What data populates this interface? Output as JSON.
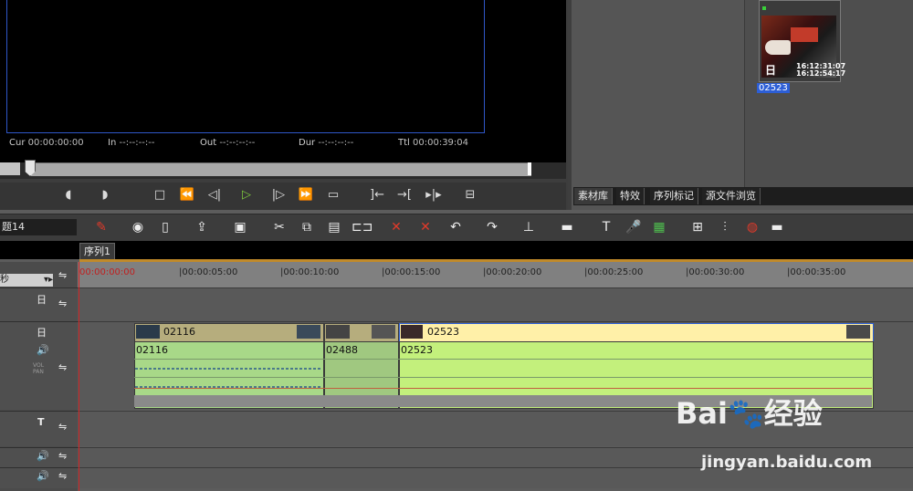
{
  "preview": {
    "cur_label": "Cur",
    "cur_value": "00:00:00:00",
    "in_label": "In",
    "in_value": "--:--:--:--",
    "out_label": "Out",
    "out_value": "--:--:--:--",
    "dur_label": "Dur",
    "dur_value": "--:--:--:--",
    "ttl_label": "Ttl",
    "ttl_value": "00:00:39:04",
    "scrub_progress": 0.0
  },
  "bin": {
    "clip_name": "02523",
    "thumb_time_1": "16:12:31:07",
    "thumb_time_2": "16:12:54:17",
    "thumb_icon": "日",
    "tabs": [
      "素材库",
      "特效",
      "序列标记",
      "源文件浏览"
    ]
  },
  "toolbar": {
    "project_name": "题14"
  },
  "timeline": {
    "sequence_tab": "序列1",
    "unit_label": "秒",
    "ruler": [
      "00:00:00:00",
      "|00:00:05:00",
      "|00:00:10:00",
      "|00:00:15:00",
      "|00:00:20:00",
      "|00:00:25:00",
      "|00:00:30:00",
      "|00:00:35:00"
    ],
    "video_clips": [
      "02116",
      "02523"
    ],
    "audio_clips": [
      "02116",
      "02488",
      "02523"
    ],
    "track_icons": {
      "video": "日",
      "audio": "🔊",
      "vol": "VOL PAN",
      "title": "T"
    }
  },
  "watermark": {
    "brand": "Bai",
    "brand2": "经验",
    "url": "jingyan.baidu.com"
  },
  "colors": {
    "accent_blue": "#2f57c9",
    "audio_green": "#c3f07c",
    "video_tan": "#b6ad7d",
    "sequence_line": "#c08a2a",
    "playhead": "#d02020"
  }
}
